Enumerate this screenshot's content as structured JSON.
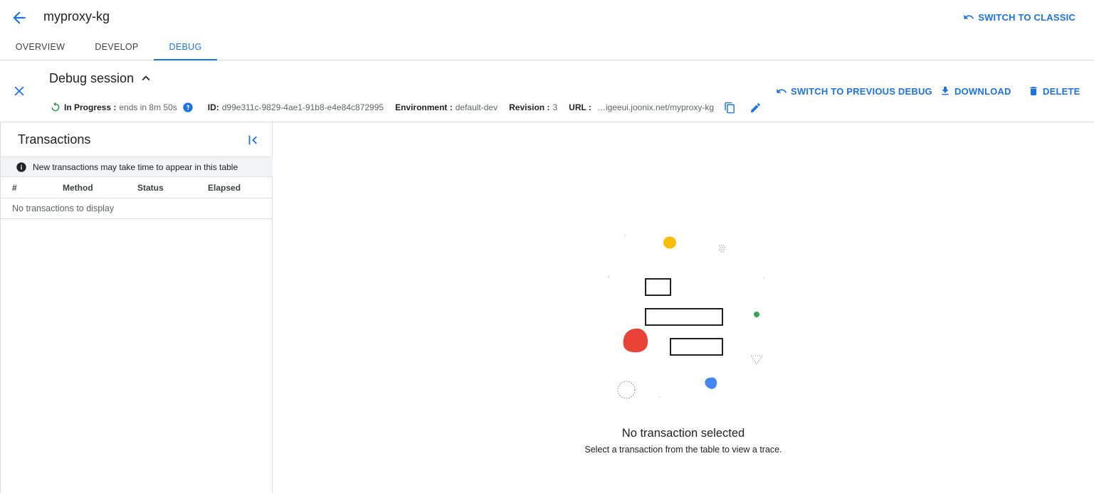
{
  "header": {
    "title": "myproxy-kg",
    "switch_classic_label": "SWITCH TO CLASSIC"
  },
  "tabs": [
    {
      "label": "OVERVIEW",
      "active": false
    },
    {
      "label": "DEVELOP",
      "active": false
    },
    {
      "label": "DEBUG",
      "active": true
    }
  ],
  "session": {
    "title": "Debug session",
    "status_label": "In Progress :",
    "status_value": "ends in 8m 50s",
    "id_label": "ID:",
    "id_value": "d99e311c-9829-4ae1-91b8-e4e84c872995",
    "environment_label": "Environment :",
    "environment_value": "default-dev",
    "revision_label": "Revision :",
    "revision_value": "3",
    "url_label": "URL :",
    "url_value": "…igeeui.joonix.net/myproxy-kg",
    "actions": {
      "switch_previous": "SWITCH TO PREVIOUS DEBUG",
      "download": "DOWNLOAD",
      "delete": "DELETE"
    }
  },
  "transactions": {
    "title": "Transactions",
    "info": "New transactions may take time to appear in this table",
    "columns": [
      "#",
      "Method",
      "Status",
      "Elapsed"
    ],
    "empty_text": "No transactions to display"
  },
  "detail": {
    "empty_title": "No transaction selected",
    "empty_subtitle": "Select a transaction from the table to view a trace."
  },
  "colors": {
    "accent": "#1a73e8",
    "status_green": "#1e8e3e",
    "yellow": "#fbbc04",
    "red": "#ea4335",
    "blue": "#4285f4",
    "green": "#34a853"
  }
}
